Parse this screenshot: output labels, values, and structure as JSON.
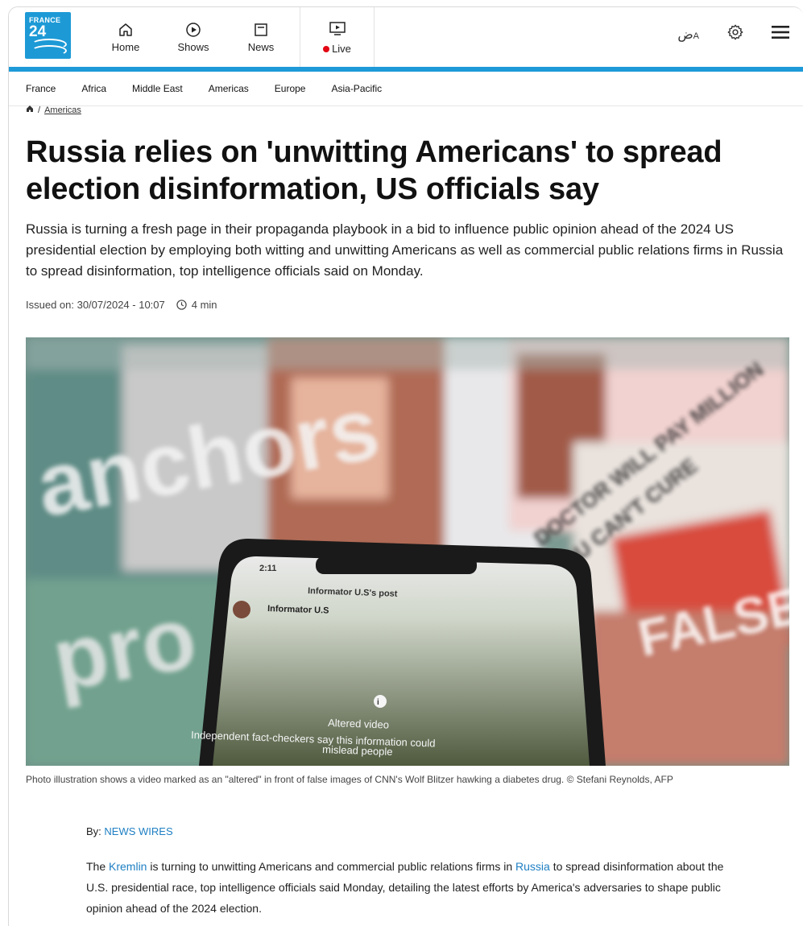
{
  "brand": {
    "logo_line1": "FRANCE",
    "logo_line2": "24"
  },
  "nav": {
    "items": [
      {
        "label": "Home",
        "icon": "home-icon"
      },
      {
        "label": "Shows",
        "icon": "play-icon"
      },
      {
        "label": "News",
        "icon": "news-icon"
      }
    ],
    "live_label": "Live",
    "live_icon": "tv-icon"
  },
  "tools": {
    "language_label": "ض",
    "language_sub": "A",
    "settings_icon": "gear-icon",
    "menu_icon": "hamburger-icon"
  },
  "colors": {
    "accent": "#1e9ad8",
    "live": "#e30613",
    "link": "#1e7fc3"
  },
  "subnav": [
    "France",
    "Africa",
    "Middle East",
    "Americas",
    "Europe",
    "Asia-Pacific"
  ],
  "breadcrumb": {
    "separator": "/",
    "section": "Americas"
  },
  "article": {
    "title": "Russia relies on 'unwitting Americans' to spread election disinformation, US officials say",
    "lede": "Russia is turning a fresh page in their propaganda playbook in a bid to influence public opinion ahead of the 2024 US presidential election by employing both witting and unwitting Americans as well as commercial public relations firms in Russia to spread disinformation, top intelligence officials said on Monday.",
    "issued": "Issued on: 30/07/2024 - 10:07",
    "read_time": "4 min",
    "photo_texts": {
      "anchors": "anchors",
      "pro": "pro",
      "false_label": "FALSE",
      "doctor": "DOCTOR WILL PAY MILLION",
      "cant_cure": "YOU CAN'T CURE",
      "phone_time": "2:11",
      "post_header": "Informator U.S's post",
      "post_author": "Informator U.S",
      "altered": "Altered video",
      "fact_check_1": "Independent fact-checkers say this information could",
      "fact_check_2": "mislead people"
    },
    "caption": "Photo illustration shows a video marked as an \"altered\" in front of false images of CNN's Wolf Blitzer hawking a diabetes drug. © Stefani Reynolds, AFP",
    "byline_label": "By:",
    "byline_source": "NEWS WIRES",
    "body": {
      "p1_a": "The ",
      "p1_link1": "Kremlin",
      "p1_b": " is turning to unwitting Americans and commercial public relations firms in ",
      "p1_link2": "Russia",
      "p1_c": " to spread disinformation about the U.S. presidential race, top intelligence officials said Monday, detailing the latest efforts by America's adversaries to shape public opinion ahead of the 2024 election."
    }
  }
}
